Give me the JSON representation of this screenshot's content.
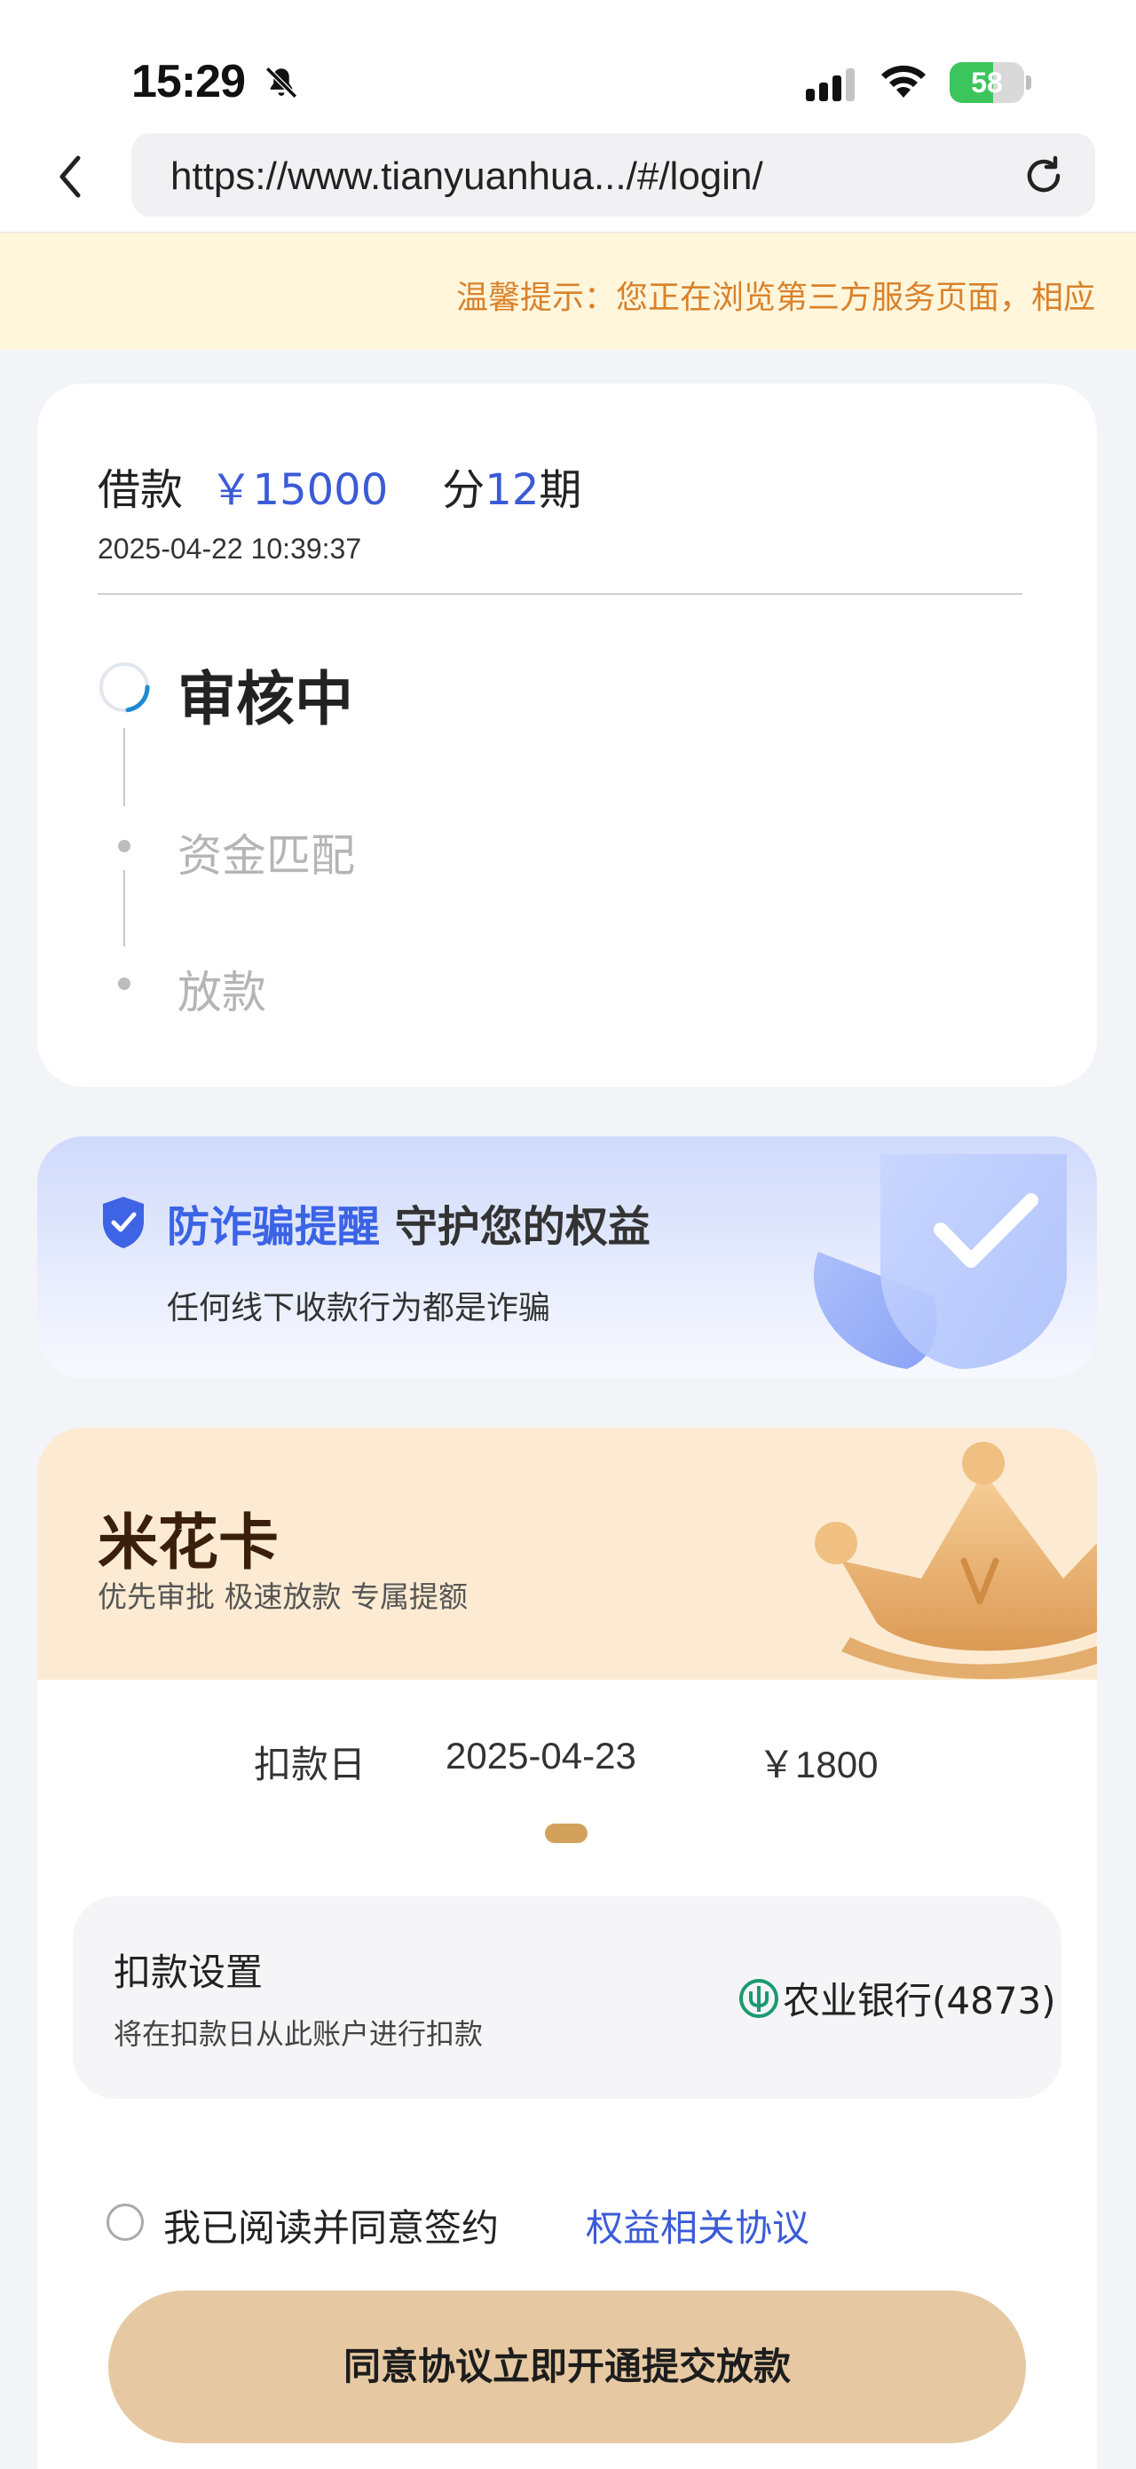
{
  "status_bar": {
    "time": "15:29",
    "battery_percent": "58",
    "battery_level": 0.58
  },
  "browser": {
    "url": "https://www.tianyuanhua.../#/login/"
  },
  "notice": {
    "text": "温馨提示：您正在浏览第三方服务页面，相应"
  },
  "loan": {
    "label": "借款",
    "amount": "￥15000",
    "installment_prefix": "分",
    "installment_count": "12",
    "installment_suffix": "期",
    "datetime": "2025-04-22 10:39:37",
    "steps": [
      {
        "label": "审核中",
        "state": "current"
      },
      {
        "label": "资金匹配",
        "state": "pending"
      },
      {
        "label": "放款",
        "state": "pending"
      }
    ]
  },
  "fraud_alert": {
    "title_accent": "防诈骗提醒",
    "title_rest": "守护您的权益",
    "subtitle": "任何线下收款行为都是诈骗"
  },
  "membership": {
    "title": "米花卡",
    "subtitle": "优先审批 极速放款 专属提额",
    "repayment": {
      "label": "扣款日",
      "date": "2025-04-23",
      "amount": "￥1800"
    },
    "deduction": {
      "title": "扣款设置",
      "subtitle": "将在扣款日从此账户进行扣款",
      "bank": "农业银行(4873)"
    },
    "agreement": {
      "text": "我已阅读并同意签约",
      "link": "权益相关协议"
    },
    "submit_label": "同意协议立即开通提交放款"
  },
  "colors": {
    "accent_blue": "#3b5bd6",
    "notice_text": "#d9822b",
    "button_gold": "#e6c9a2",
    "bank_green": "#1a9a6f"
  }
}
